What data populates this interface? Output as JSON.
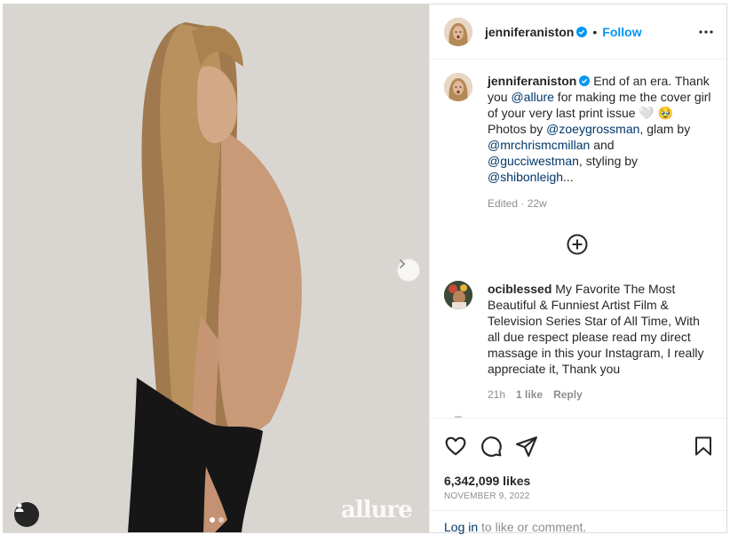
{
  "post": {
    "username": "jenniferaniston",
    "follow_label": "Follow",
    "header_separator": "•",
    "watermark": "allure"
  },
  "caption": {
    "username": "jenniferaniston",
    "text_1": "End of an era. Thank you ",
    "mention_allure": "@allure",
    "text_2": " for making me the cover girl of your very last print issue 🤍 🥹 Photos by ",
    "mention_zoey": "@zoeygrossman",
    "text_3": ", glam by ",
    "mention_chris": "@mrchrismcmillan",
    "text_4": " and ",
    "mention_gucci": "@gucciwestman",
    "text_5": ", styling by ",
    "mention_shibon": "@shibonleigh",
    "text_6": "...",
    "meta": "Edited · 22w"
  },
  "comment": {
    "username": "ociblessed",
    "text": "My Favorite The Most Beautiful & Funniest Artist Film & Television Series Star of All Time, With all due respect please read my direct massage in this your Instagram, I really appreciate it, Thank you",
    "time": "21h",
    "likes": "1 like",
    "reply": "Reply"
  },
  "actions": {
    "likes": "6,342,099 likes",
    "date": "NOVEMBER 9, 2022",
    "login_link": "Log in",
    "login_rest": " to like or comment."
  },
  "icons": [
    "avatar",
    "verified-icon",
    "more-options-icon",
    "load-more-comments-icon",
    "heart-icon",
    "comment-icon",
    "share-icon",
    "save-icon",
    "next-slide-icon",
    "tagged-user-icon"
  ],
  "colors": {
    "accent": "#0095f6",
    "mention": "#00376b",
    "secondary_text": "#8e8e8e",
    "border": "#efefef"
  }
}
